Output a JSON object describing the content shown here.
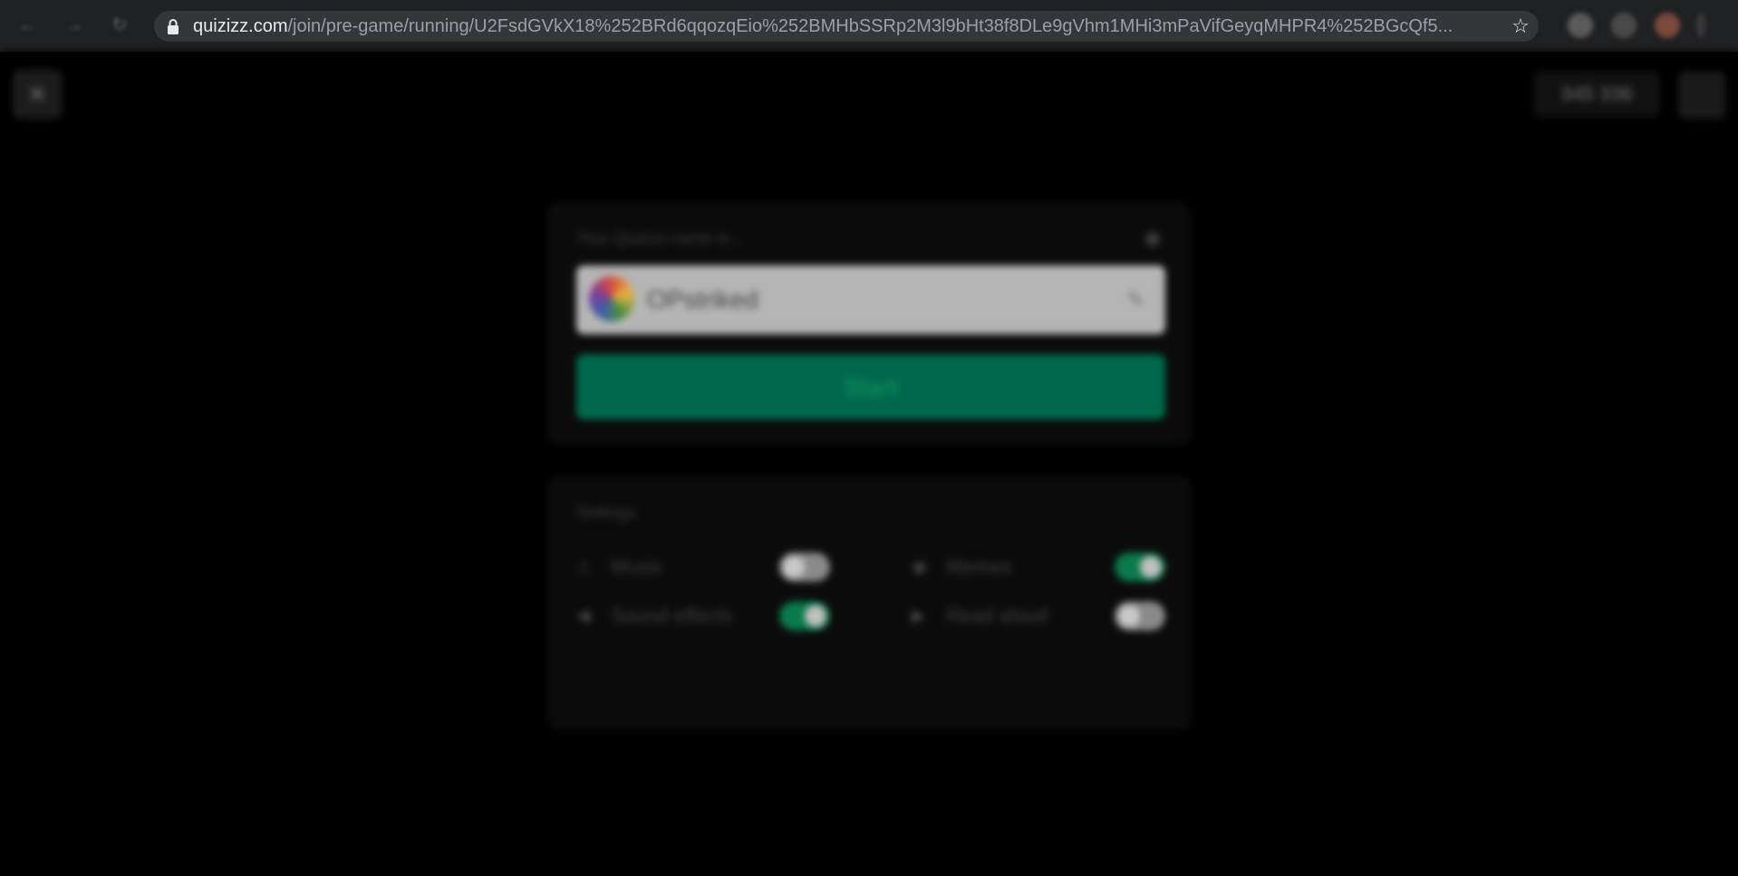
{
  "browser": {
    "url_host": "quizizz.com",
    "url_path": "/join/pre-game/running/U2FsdGVkX18%252BRd6qqozqEio%252BMHbSSRp2M3l9bHt38f8DLe9gVhm1MHi3mPaVifGeyqMHPR4%252BGcQf5...",
    "nav_icons": [
      "back-icon",
      "forward-icon",
      "reload-icon"
    ],
    "omnibox_icons": [
      "lock-icon",
      "star-icon"
    ]
  },
  "header": {
    "close_icon": "close-icon",
    "game_code": "345 336",
    "menu_icon": "menu-icon"
  },
  "name_card": {
    "prompt": "Your Quizizz name is...",
    "name": "OPstriked",
    "start_label": "Start"
  },
  "settings": {
    "title": "Settings",
    "items": [
      {
        "label": "Music",
        "icon": "music-icon",
        "enabled": false
      },
      {
        "label": "Memes",
        "icon": "memes-icon",
        "enabled": true
      },
      {
        "label": "Sound effects",
        "icon": "speaker-icon",
        "enabled": true
      },
      {
        "label": "Read aloud",
        "icon": "read-aloud-icon",
        "enabled": false
      }
    ]
  },
  "colors": {
    "start_green": "#00684a",
    "toggle_on": "#0a7a4a",
    "toggle_off": "#8a8a8a"
  }
}
